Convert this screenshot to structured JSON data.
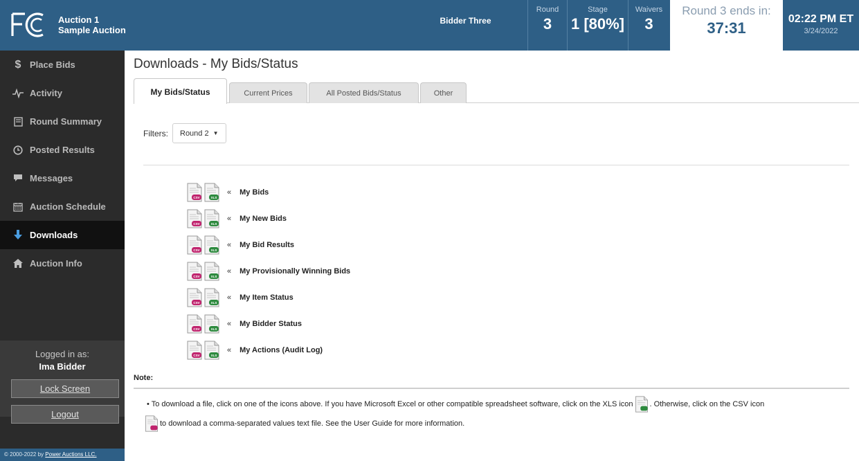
{
  "header": {
    "auction_title": "Auction 1",
    "auction_subtitle": "Sample Auction",
    "bidder": "Bidder Three",
    "round_label": "Round",
    "round_value": "3",
    "stage_label": "Stage",
    "stage_value": "1 [80%]",
    "waivers_label": "Waivers",
    "waivers_value": "3",
    "timer_label": "Round 3 ends in:",
    "timer_value": "37:31",
    "clock_time": "02:22 PM ET",
    "clock_date": "3/24/2022"
  },
  "sidebar": {
    "items": [
      {
        "label": "Place Bids",
        "icon": "dollar-icon"
      },
      {
        "label": "Activity",
        "icon": "pulse-icon"
      },
      {
        "label": "Round Summary",
        "icon": "document-icon"
      },
      {
        "label": "Posted Results",
        "icon": "clock-icon"
      },
      {
        "label": "Messages",
        "icon": "comment-icon"
      },
      {
        "label": "Auction Schedule",
        "icon": "calendar-icon"
      },
      {
        "label": "Downloads",
        "icon": "download-arrow-icon",
        "active": true
      },
      {
        "label": "Auction Info",
        "icon": "home-icon"
      }
    ],
    "logged_in_label": "Logged in as:",
    "user_name": "Ima Bidder",
    "lock_screen": "Lock Screen",
    "logout": "Logout",
    "copyright_prefix": "© 2000-2022 by ",
    "copyright_company": "Power Auctions LLC."
  },
  "main": {
    "title": "Downloads - My Bids/Status",
    "tabs": [
      {
        "label": "My Bids/Status",
        "active": true
      },
      {
        "label": "Current Prices"
      },
      {
        "label": "All Posted Bids/Status"
      },
      {
        "label": "Other"
      }
    ],
    "filters_label": "Filters:",
    "filter_value": "Round 2",
    "chevron": "«",
    "downloads": [
      "My Bids",
      "My New Bids",
      "My Bid Results",
      "My Provisionally Winning Bids",
      "My Item Status",
      "My Bidder Status",
      "My Actions (Audit Log)"
    ],
    "note_label": "Note:",
    "note_part1": "• To download a file, click on one of the icons above. If you have Microsoft Excel or other compatible spreadsheet software, click on the XLS icon",
    "note_part2": ". Otherwise, click on the CSV icon",
    "note_part3": "to download a comma-separated values text file. See the User Guide for more information.",
    "csv_badge": "CSV",
    "xls_badge": "XLS"
  },
  "colors": {
    "header_bg": "#2e5f86",
    "sidebar_bg": "#2b2b2b",
    "active_nav_bg": "#111111",
    "csv_badge": "#c0246e",
    "xls_badge": "#2d8a3e"
  }
}
